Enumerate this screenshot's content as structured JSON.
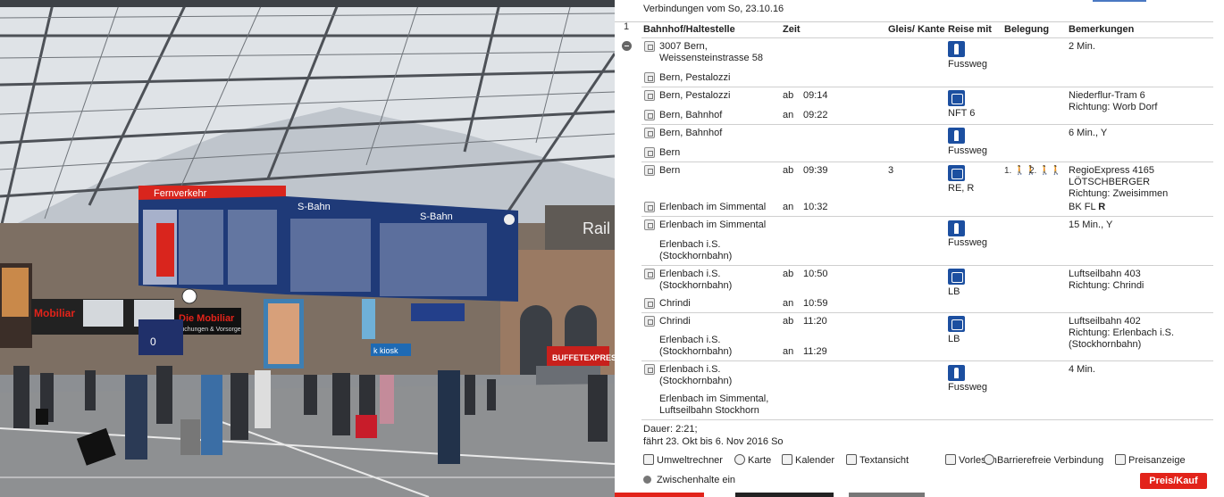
{
  "photo": {
    "board_left_title": "Fernverkehr",
    "board_mid_title": "S-Bahn",
    "board_right_title": "S-Bahn",
    "ad_mobiliar_1": "Mobiliar",
    "ad_mobiliar_2": "Die Mobiliar",
    "ad_mobiliar_2_sub": "ruchungen & Vorsorge",
    "ad_kiosk": "k kiosk",
    "ad_buffet": "BUFFETEXPRESS",
    "ad_rail": "Rail",
    "clock_digit": "0"
  },
  "panel": {
    "date_header": "Verbindungen vom So, 23.10.16",
    "row_index": "1",
    "columns": {
      "station": "Bahnhof/Haltestelle",
      "time": "Zeit",
      "platform": "Gleis/ Kante",
      "mode": "Reise mit",
      "occupancy": "Belegung",
      "remarks": "Bemerkungen"
    },
    "segments": [
      {
        "from": "3007 Bern, Weissensteinstrasse 58",
        "to": "Bern, Pestalozzi",
        "mode": "Fussweg",
        "remarks": "2 Min."
      },
      {
        "from": "Bern, Pestalozzi",
        "dep_lbl": "ab",
        "dep": "09:14",
        "to": "Bern, Bahnhof",
        "arr_lbl": "an",
        "arr": "09:22",
        "mode": "NFT 6",
        "remarks": "Niederflur-Tram 6\nRichtung: Worb Dorf"
      },
      {
        "from": "Bern, Bahnhof",
        "to": "Bern",
        "mode": "Fussweg",
        "remarks": "6 Min., Y"
      },
      {
        "from": "Bern",
        "dep_lbl": "ab",
        "dep": "09:39",
        "platform": "3",
        "to": "Erlenbach im Simmental",
        "arr_lbl": "an",
        "arr": "10:32",
        "mode": "RE, R",
        "occ1": "1.",
        "occ2": "2.",
        "remarks": "RegioExpress 4165\nLÖTSCHBERGER\nRichtung: Zweisimmen",
        "remarks2": "BK FL",
        "remarks2b": "R"
      },
      {
        "from": "Erlenbach im Simmental",
        "to": "Erlenbach i.S. (Stockhornbahn)",
        "mode": "Fussweg",
        "remarks": "15 Min., Y"
      },
      {
        "from": "Erlenbach i.S. (Stockhornbahn)",
        "dep_lbl": "ab",
        "dep": "10:50",
        "to": "Chrindi",
        "arr_lbl": "an",
        "arr": "10:59",
        "mode": "LB",
        "remarks": "Luftseilbahn 403\nRichtung: Chrindi"
      },
      {
        "from": "Chrindi",
        "dep_lbl": "ab",
        "dep": "11:20",
        "to": "Erlenbach i.S. (Stockhornbahn)",
        "arr_lbl": "an",
        "arr": "11:29",
        "mode": "LB",
        "remarks": "Luftseilbahn 402\nRichtung: Erlenbach i.S.\n(Stockhornbahn)"
      },
      {
        "from": "Erlenbach i.S. (Stockhornbahn)",
        "to": "Erlenbach im Simmental, Luftseilbahn Stockhorn",
        "mode": "Fussweg",
        "remarks": "4 Min."
      }
    ],
    "duration": "Dauer: 2:21;",
    "validity": "fährt 23. Okt bis 6. Nov 2016 So",
    "tools": [
      "Umweltrechner",
      "Karte",
      "Kalender",
      "Textansicht",
      "Vorlesen",
      "Barrierefreie Verbindung",
      "Preisanzeige"
    ],
    "zwischenhalte": "Zwischenhalte ein",
    "buy_button": "Preis/Kauf",
    "colors": {
      "mode_icon": "#1c4fa0",
      "buy_button": "#e2231a",
      "board_red": "#d9251d",
      "board_blue": "#1f3a78"
    }
  }
}
